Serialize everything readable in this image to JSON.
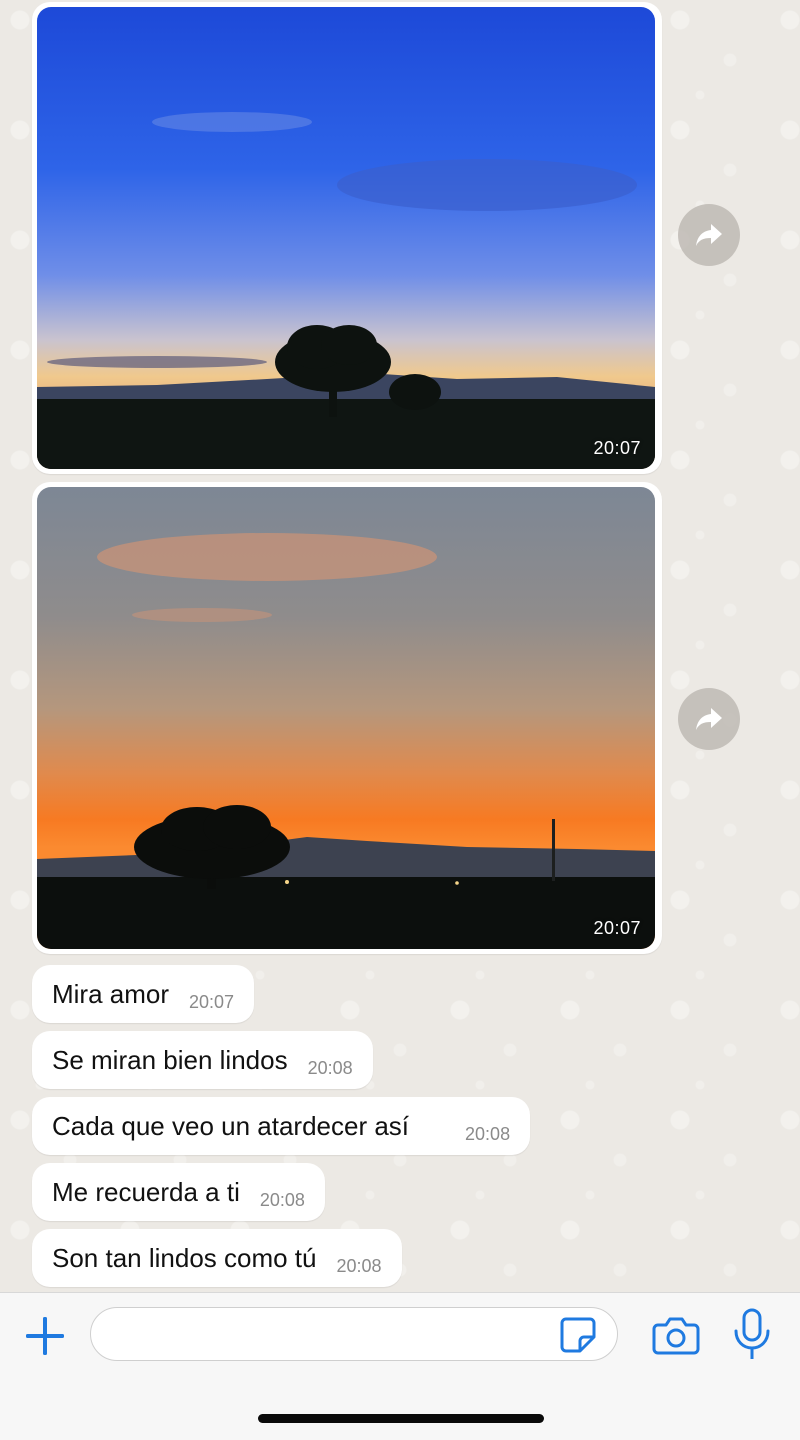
{
  "chat": {
    "photos": [
      {
        "time": "20:07",
        "description_icon": "forward-icon"
      },
      {
        "time": "20:07",
        "description_icon": "forward-icon"
      }
    ],
    "messages": [
      {
        "text": "Mira amor",
        "time": "20:07"
      },
      {
        "text": "Se miran bien lindos",
        "time": "20:08"
      },
      {
        "text": "Cada que veo un atardecer así",
        "time": "20:08"
      },
      {
        "text": "Me recuerda a ti",
        "time": "20:08"
      },
      {
        "text": "Son tan lindos como tú",
        "time": "20:08"
      }
    ]
  },
  "input_bar": {
    "placeholder": "",
    "icons": [
      "plus-icon",
      "sticker-icon",
      "camera-icon",
      "microphone-icon"
    ]
  },
  "colors": {
    "accent": "#1f7ae0",
    "bubble": "#ffffff",
    "chat_bg": "#ece9e4",
    "timestamp": "#8a8a8a"
  }
}
